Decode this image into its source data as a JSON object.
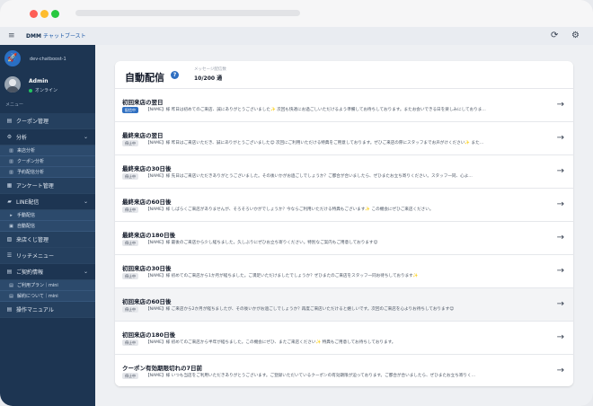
{
  "app": {
    "logo_main": "DMM",
    "logo_sub": "チャットブースト"
  },
  "colors": {
    "sidebar": "#1d3552",
    "accent": "#2f6fc1",
    "dot_red": "#fe5f57",
    "dot_yellow": "#febc2e",
    "dot_green": "#28c840"
  },
  "topbar": {
    "menu_icon": "≡",
    "refresh_icon": "⟳",
    "settings_icon": "⚙"
  },
  "account": {
    "name": "dev-chatboost-1"
  },
  "user": {
    "name": "Admin",
    "status": "オンライン"
  },
  "menu_label": "メニュー",
  "nav": {
    "coupon_admin": "クーポン管理",
    "analytics": "分析",
    "visit_analytics": "来店分析",
    "coupon_analytics": "クーポン分析",
    "scheduled_analytics": "予約配信分析",
    "survey_admin": "アンケート管理",
    "line_delivery": "LINE配信",
    "manual_delivery": "手動配信",
    "auto_delivery": "自動配信",
    "visit_lottery_admin": "来店くじ管理",
    "rich_menu": "リッチメニュー",
    "contract_info": "ご契約情報",
    "plan_usage": "ご利用プラン｜mini",
    "about_contract": "解約について｜mini",
    "manual": "操作マニュアル"
  },
  "page": {
    "title": "自動配信",
    "help": "?",
    "count_label": "メッセージ配信数",
    "count_value": "10/200 通"
  },
  "rows": [
    {
      "title": "初回来店の翌日",
      "badge": "配信中",
      "active": true,
      "text": "【NAME】様 昨日は初めてのご来店、誠にありがとうございました✨ 次回も快適にお過ごしいただけるよう準備してお待ちしております。またお会いできる日を楽しみにしておりま…"
    },
    {
      "title": "最終来店の翌日",
      "badge": "停止中",
      "active": false,
      "text": "【NAME】様 昨日はご来店いただき、誠にありがとうございました😊 次回にご利用いただける特典をご用意しております。ぜひご来店の際にスタッフまでお声がけください✨ また…"
    },
    {
      "title": "最終来店の30日後",
      "badge": "停止中",
      "active": false,
      "text": "【NAME】様 先日はご来店いただきありがとうございました。その後いかがお過ごしでしょうか？ご都合が合いましたら、ぜひまたお立ち寄りください。スタッフ一同、心よ…"
    },
    {
      "title": "最終来店の60日後",
      "badge": "停止中",
      "active": false,
      "text": "【NAME】様 しばらくご来店がありませんが、そろそろいかがでしょうか？今ならご利用いただける特典もございます✨ この機会にぜひご来店ください。"
    },
    {
      "title": "最終来店の180日後",
      "badge": "停止中",
      "active": false,
      "text": "【NAME】様 最後のご来店から少し経ちました。久しぶりにぜひお立ち寄りください。特別なご案内もご用意しております😊"
    },
    {
      "title": "初回来店の30日後",
      "badge": "停止中",
      "active": false,
      "text": "【NAME】様 初めてのご来店から1か月が経ちました。ご満足いただけましたでしょうか？ぜひまたのご来店をスタッフ一同お待ちしております✨"
    },
    {
      "title": "初回来店の60日後",
      "badge": "停止中",
      "active": false,
      "text": "【NAME】様 ご来店から2か月が経ちましたが、その後いかがお過ごしでしょうか？再度ご来店いただけると嬉しいです。次回のご来店を心よりお待ちしております😊"
    },
    {
      "title": "初回来店の180日後",
      "badge": "停止中",
      "active": false,
      "text": "【NAME】様 初めてのご来店から半年が経ちました。この機会にぜひ、またご来店ください✨ 特典もご用意してお待ちしております。"
    },
    {
      "title": "クーポン有効期限切れの7日前",
      "badge": "停止中",
      "active": false,
      "text": "【NAME】様 いつも当店をご利用いただきありがとうございます。ご登録いただいているクーポンの有効期限が迫っております。ご都合が合いましたら、ぜひまたお立ち寄りく…"
    }
  ]
}
